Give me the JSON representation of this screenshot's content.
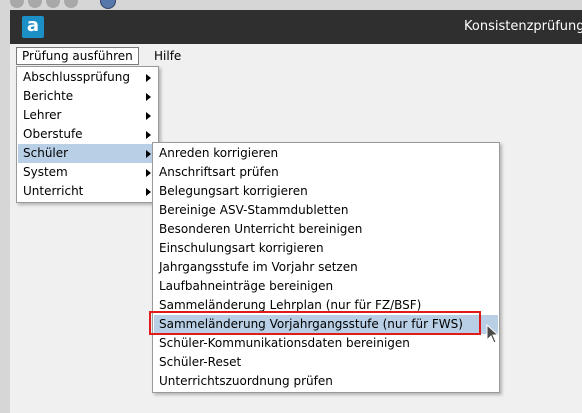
{
  "window": {
    "title": "Konsistenzprüfung",
    "logo_letter": "a"
  },
  "menubar": {
    "items": [
      "Prüfung ausführen",
      "Hilfe"
    ]
  },
  "pruefung_menu": {
    "items": [
      "Abschlussprüfung",
      "Berichte",
      "Lehrer",
      "Oberstufe",
      "Schüler",
      "System",
      "Unterricht"
    ],
    "selected": "Schüler"
  },
  "schueler_submenu": {
    "items": [
      "Anreden korrigieren",
      "Anschriftsart prüfen",
      "Belegungsart korrigieren",
      "Bereinige ASV-Stammdubletten",
      "Besonderen Unterricht bereinigen",
      "Einschulungsart korrigieren",
      "Jahrgangsstufe im Vorjahr setzen",
      "Laufbahneinträge bereinigen",
      "Sammeländerung Lehrplan (nur für FZ/BSF)",
      "Sammeländerung Vorjahrgangsstufe (nur für FWS)",
      "Schüler-Kommunikationsdaten bereinigen",
      "Schüler-Reset",
      "Unterrichtszuordnung prüfen"
    ],
    "highlighted": "Sammeländerung Vorjahrgangsstufe (nur für FWS)"
  },
  "colors": {
    "titlebar": "#2f2f2f",
    "logo": "#1c8fc7",
    "hover": "#b8cfe5",
    "annotation": "#e01b1b"
  }
}
